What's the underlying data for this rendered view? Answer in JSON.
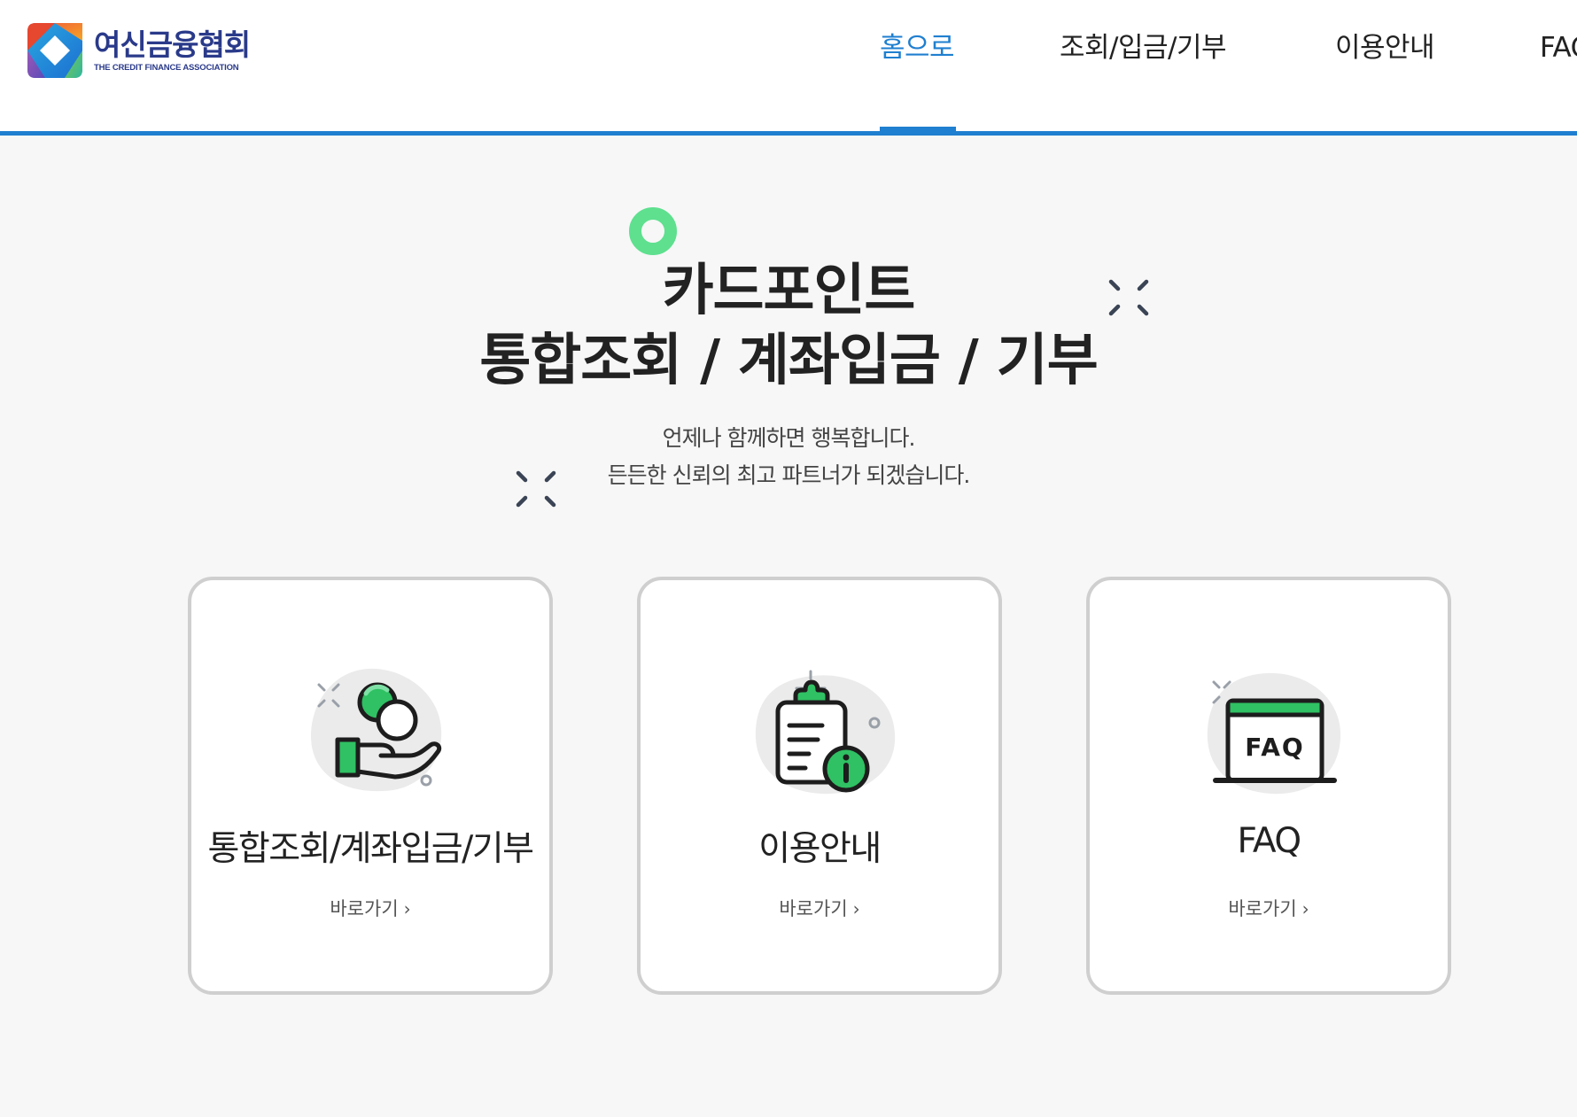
{
  "header": {
    "logo_korean": "여신금융협회",
    "logo_english": "THE CREDIT FINANCE ASSOCIATION",
    "nav": [
      {
        "label": "홈으로",
        "active": true
      },
      {
        "label": "조회/입금/기부",
        "active": false
      },
      {
        "label": "이용안내",
        "active": false
      },
      {
        "label": "FAQ",
        "active": false
      }
    ]
  },
  "hero": {
    "title_line1": "카드포인트",
    "title_line2": "통합조회 / 계좌입금 / 기부",
    "subtitle_line1": "언제나 함께하면 행복합니다.",
    "subtitle_line2": "든든한 신뢰의 최고 파트너가 되겠습니다."
  },
  "cards": [
    {
      "title": "통합조회/계좌입금/기부",
      "link": "바로가기",
      "icon": "hand-coins-icon"
    },
    {
      "title": "이용안내",
      "link": "바로가기",
      "icon": "clipboard-info-icon"
    },
    {
      "title": "FAQ",
      "link": "바로가기",
      "icon": "faq-window-icon"
    }
  ],
  "colors": {
    "accent": "#1f7fd0",
    "icon_green": "#2fc163",
    "circle_green": "#5ee08f",
    "background": "#f7f7f7"
  }
}
